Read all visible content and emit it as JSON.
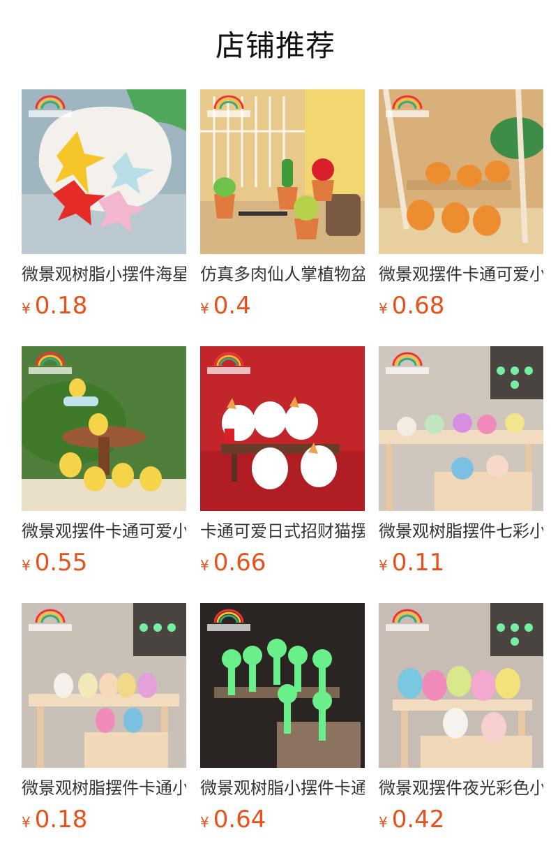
{
  "page": {
    "title": "店铺推荐"
  },
  "products": [
    {
      "title": "微景观树脂小摆件海星",
      "currency": "¥",
      "price": "0.18",
      "image": "starfish-in-shell"
    },
    {
      "title": "仿真多肉仙人掌植物盆栽",
      "currency": "¥",
      "price": "0.4",
      "image": "succulent-pots"
    },
    {
      "title": "微景观摆件卡通可爱小老虎",
      "currency": "¥",
      "price": "0.68",
      "image": "tiger-figures"
    },
    {
      "title": "微景观摆件卡通可爱小鸡",
      "currency": "¥",
      "price": "0.55",
      "image": "chick-figures"
    },
    {
      "title": "卡通可爱日式招财猫摆件",
      "currency": "¥",
      "price": "0.66",
      "image": "lucky-cats"
    },
    {
      "title": "微景观树脂摆件七彩小鸭",
      "currency": "¥",
      "price": "0.11",
      "image": "glow-ducks"
    },
    {
      "title": "微景观树脂摆件卡通小兔",
      "currency": "¥",
      "price": "0.18",
      "image": "glow-rabbits"
    },
    {
      "title": "微景观树脂小摆件卡通精灵",
      "currency": "¥",
      "price": "0.64",
      "image": "glow-spirits"
    },
    {
      "title": "微景观摆件夜光彩色小熊",
      "currency": "¥",
      "price": "0.42",
      "image": "glow-bears"
    }
  ]
}
